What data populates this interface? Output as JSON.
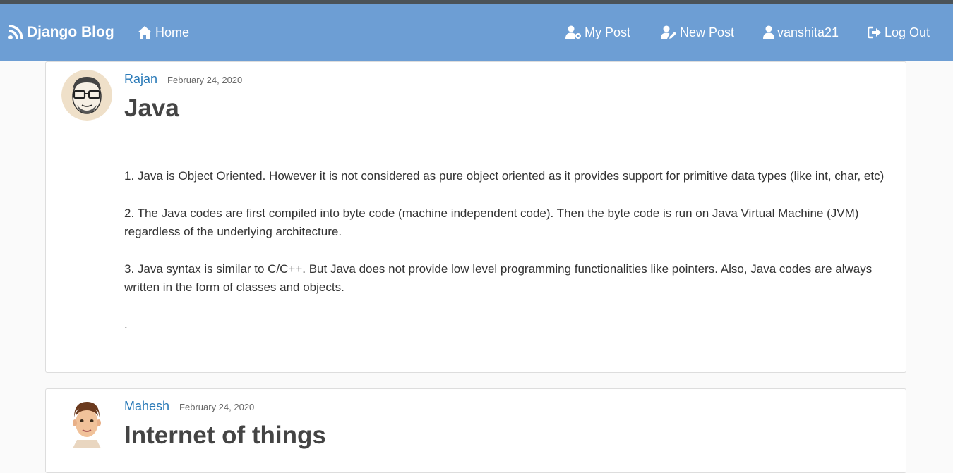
{
  "navbar": {
    "brand": "Django Blog",
    "home": "Home",
    "my_post": "My Post",
    "new_post": "New Post",
    "username": "vanshita21",
    "logout": "Log Out",
    "color": "#6d9ed4"
  },
  "posts": [
    {
      "author": "Rajan",
      "date": "February 24, 2020",
      "title": "Java",
      "paragraphs": [
        "1. Java is Object Oriented. However it is not considered as pure object oriented as it provides support for primitive data types (like int, char, etc)",
        "2. The Java codes are first compiled into byte code (machine independent code). Then the byte code is run on Java Virtual Machine (JVM) regardless of the underlying architecture.",
        "3. Java syntax is similar to C/C++. But Java does not provide low level programming functionalities like pointers. Also, Java codes are always written in the form of classes and objects.",
        "."
      ]
    },
    {
      "author": "Mahesh",
      "date": "February 24, 2020",
      "title": "Internet of things"
    }
  ]
}
